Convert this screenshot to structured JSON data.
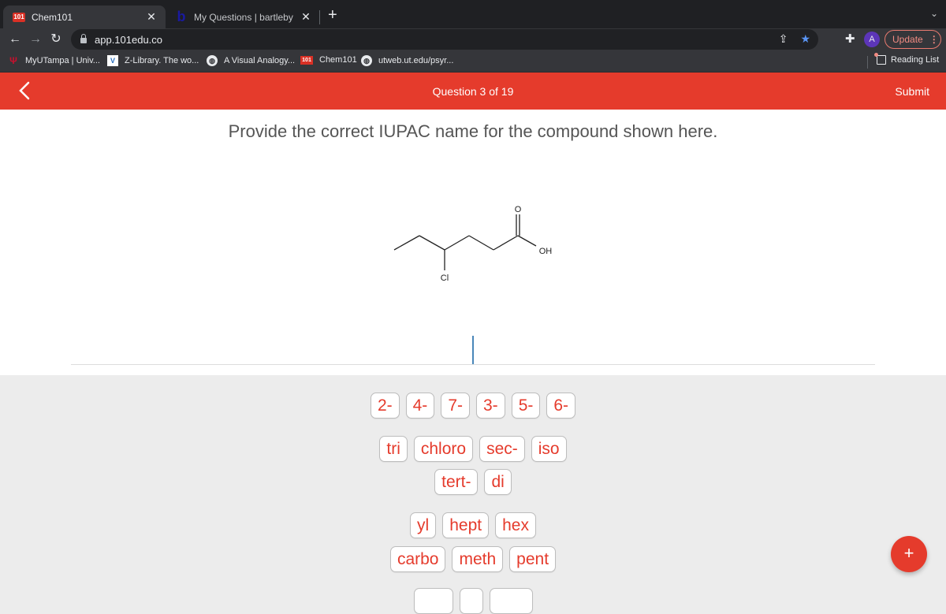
{
  "browser": {
    "tabs": [
      {
        "title": "Chem101",
        "favicon": "101-logo-icon",
        "active": true
      },
      {
        "title": "My Questions | bartleby",
        "favicon": "bartleby-b-icon",
        "active": false
      }
    ],
    "new_tab_label": "+",
    "url": "app.101edu.co",
    "profile_initial": "A",
    "update_label": "Update",
    "bookmarks": [
      {
        "label": "MyUTampa | Univ...",
        "icon": "utampa-icon"
      },
      {
        "label": "Z-Library. The wo...",
        "icon": "zlibrary-icon"
      },
      {
        "label": "A Visual Analogy...",
        "icon": "globe-icon"
      },
      {
        "label": "Chem101",
        "icon": "101-logo-icon"
      },
      {
        "label": "utweb.ut.edu/psyr...",
        "icon": "globe-icon"
      }
    ],
    "reading_list_label": "Reading List"
  },
  "app": {
    "header": {
      "question_counter": "Question 3 of 19",
      "submit_label": "Submit"
    },
    "question": {
      "prompt": "Provide the correct IUPAC name for the compound shown here.",
      "molecule": {
        "substituent_label": "Cl",
        "carbonyl_label": "O",
        "hydroxyl_label": "OH"
      },
      "answer_value": ""
    },
    "tiles": {
      "row1": [
        "2-",
        "4-",
        "7-",
        "3-",
        "5-",
        "6-"
      ],
      "row2": [
        "tri",
        "chloro",
        "sec-",
        "iso"
      ],
      "row3": [
        "tert-",
        "di"
      ],
      "row4": [
        "yl",
        "hept",
        "hex"
      ],
      "row5": [
        "carbo",
        "meth",
        "pent"
      ]
    },
    "fab_label": "+",
    "colors": {
      "brand_red": "#e53b2c",
      "cursor_blue": "#4a87b9"
    }
  }
}
